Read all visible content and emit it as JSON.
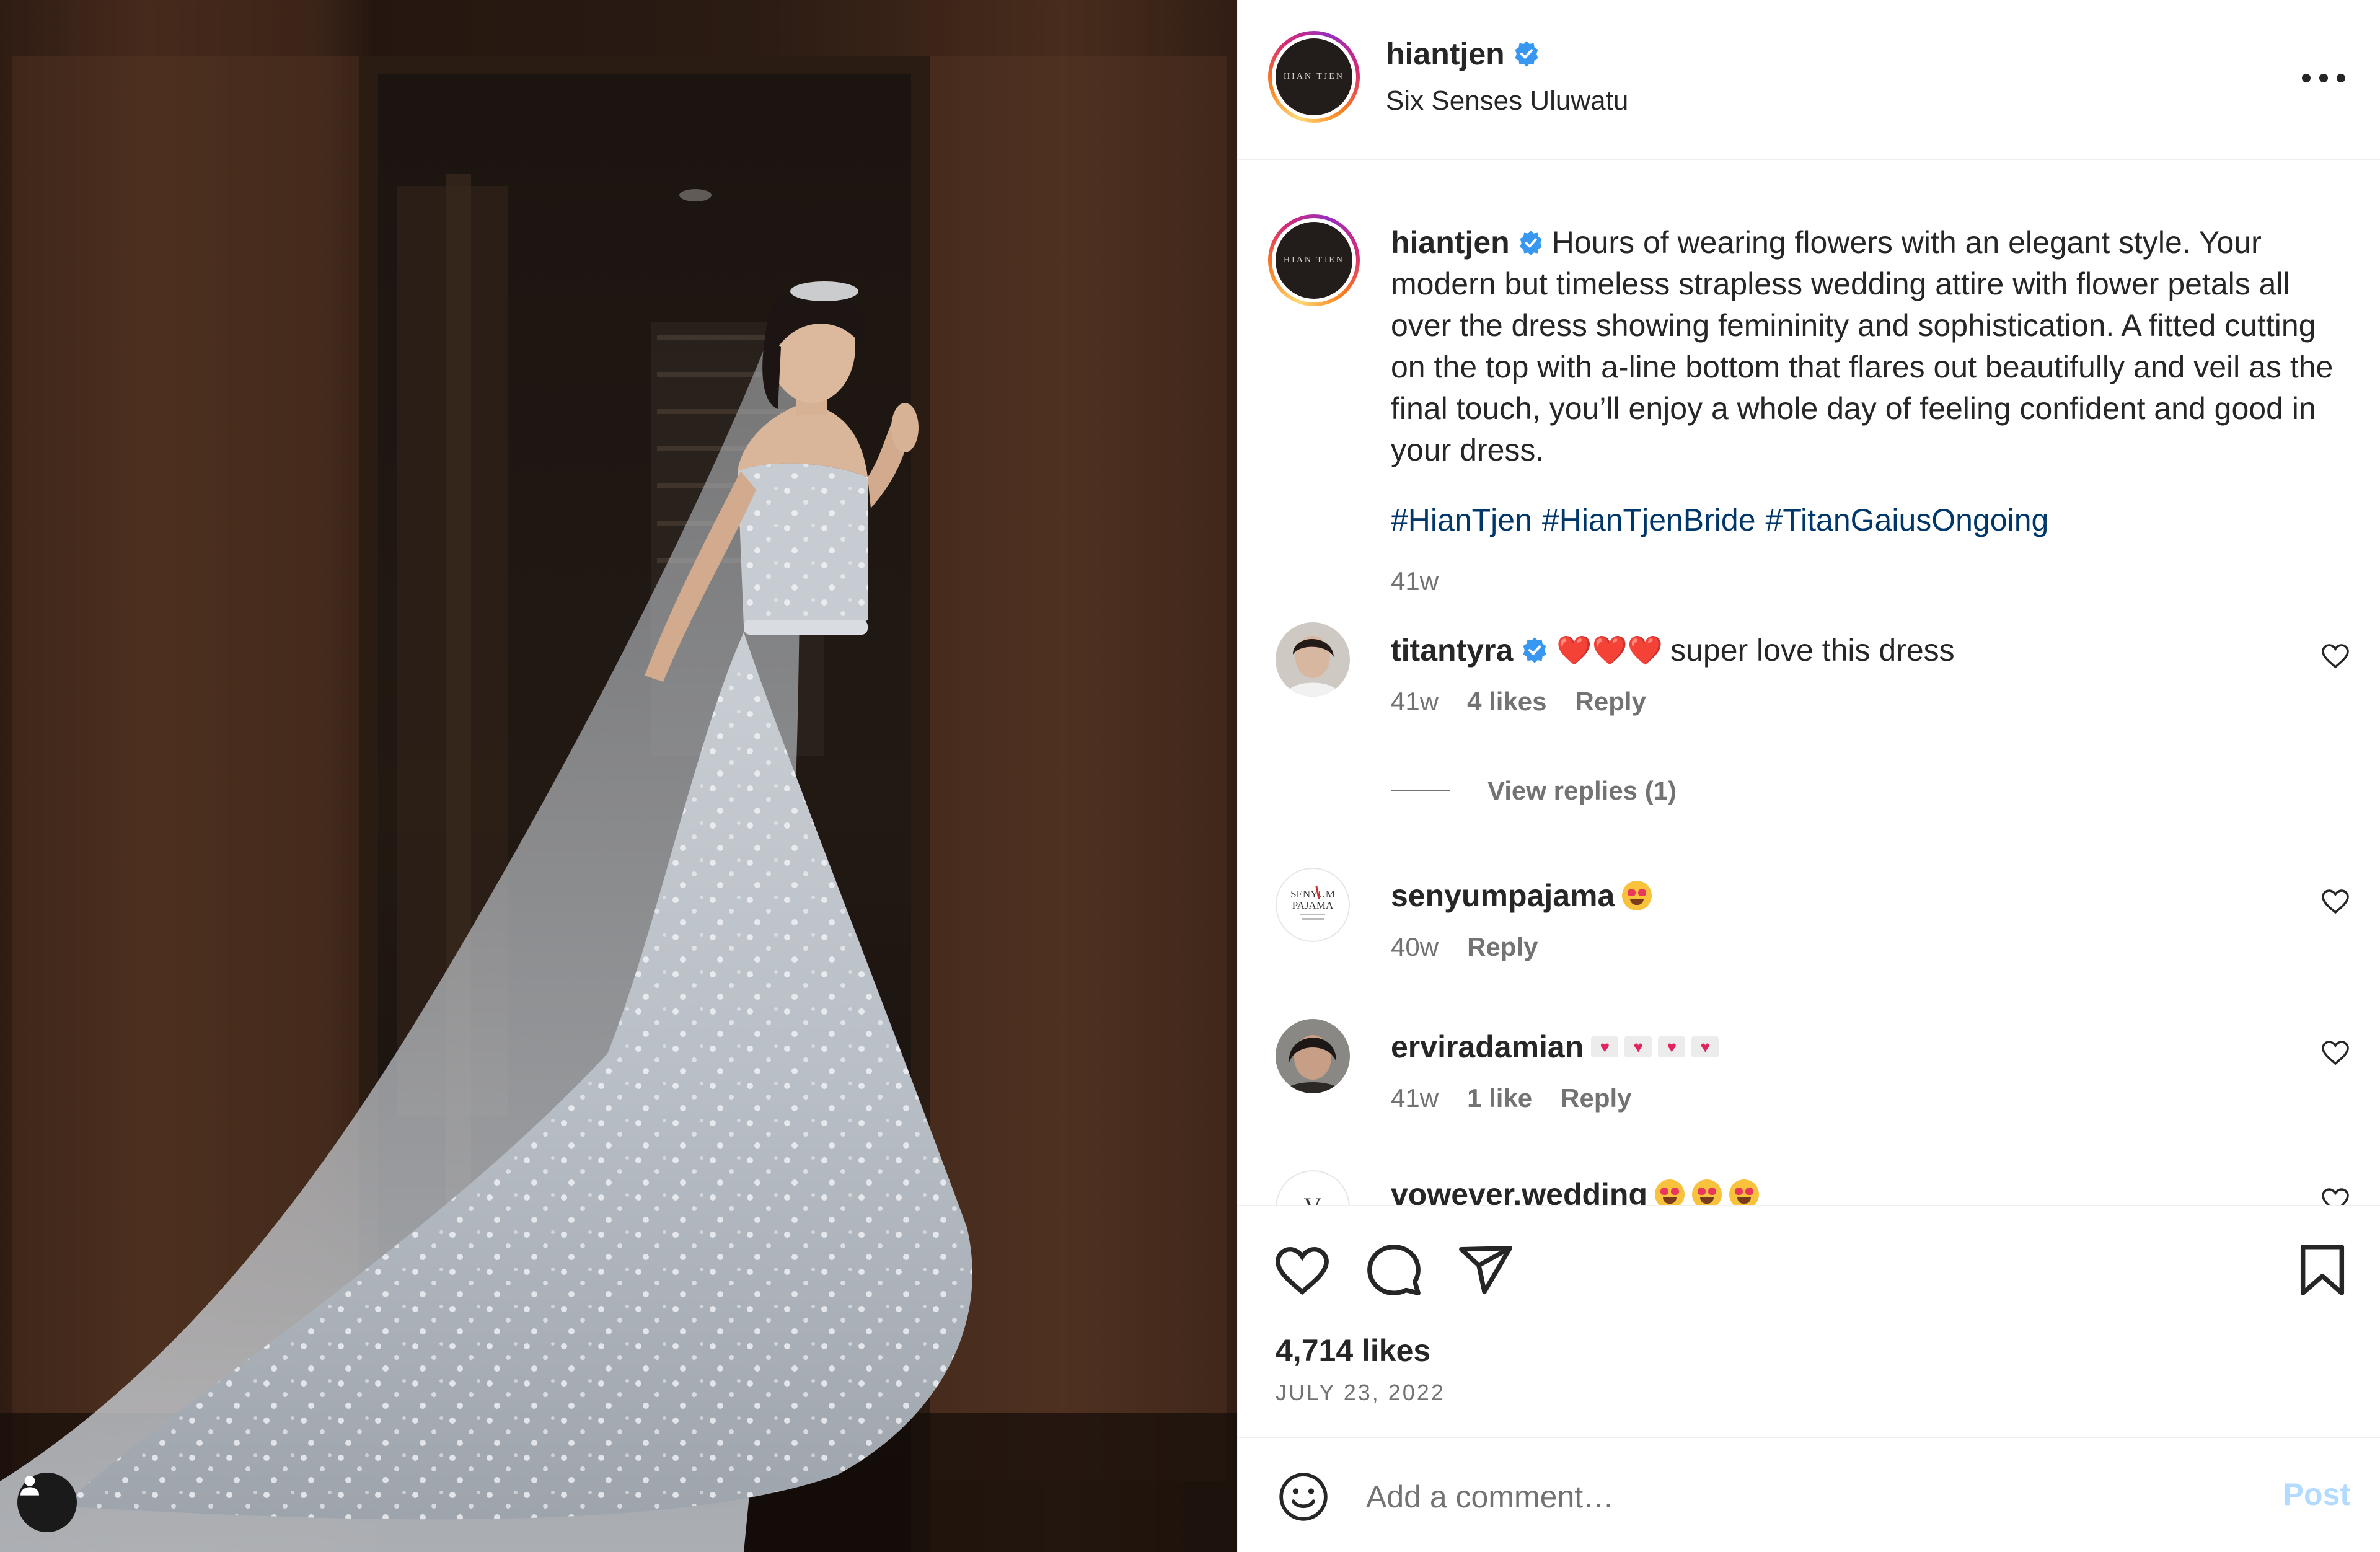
{
  "post": {
    "username": "hiantjen",
    "avatar_text": "HIAN TJEN",
    "location": "Six Senses Uluwatu",
    "caption": "Hours of wearing flowers with an elegant style. Your modern but timeless strapless wedding attire with flower petals all over the dress showing femininity and sophistication. A fitted cutting on the top with a-line bottom that flares out beautifully and veil as the final touch, you’ll enjoy a whole day of feeling confident and good in your dress.",
    "hashtags": [
      "#HianTjen",
      "#HianTjenBride",
      "#TitanGaiusOngoing"
    ],
    "caption_time": "41w",
    "likes": "4,714 likes",
    "date": "JULY 23, 2022"
  },
  "comments": [
    {
      "username": "titantyra",
      "verified": true,
      "emoji": "❤️❤️❤️",
      "text": "super love this dress",
      "time": "41w",
      "likes": "4 likes",
      "reply": "Reply"
    },
    {
      "username": "senyumpajama",
      "verified": false,
      "emoji": "😍",
      "text": "",
      "time": "40w",
      "likes": "",
      "reply": "Reply",
      "avatar_text": "SENYUM PAJAMA"
    },
    {
      "username": "erviradamian",
      "verified": false,
      "emoji": "💌💌💌💌",
      "text": "",
      "time": "41w",
      "likes": "1 like",
      "reply": "Reply"
    },
    {
      "username": "vowever.wedding",
      "verified": false,
      "emoji": "😍😍😍",
      "text": "",
      "avatar_text": "V"
    }
  ],
  "view_replies": "View replies (1)",
  "add_comment": {
    "placeholder": "Add a comment…",
    "post_label": "Post"
  },
  "icons": [
    "verified-badge-icon",
    "more-options-icon",
    "heart-icon",
    "comment-icon",
    "share-icon",
    "bookmark-icon",
    "emoji-icon",
    "user-tag-icon"
  ],
  "colors": {
    "link": "#00376b",
    "muted": "#737373",
    "verified": "#3897f0",
    "post_disabled": "#b3dbff"
  }
}
